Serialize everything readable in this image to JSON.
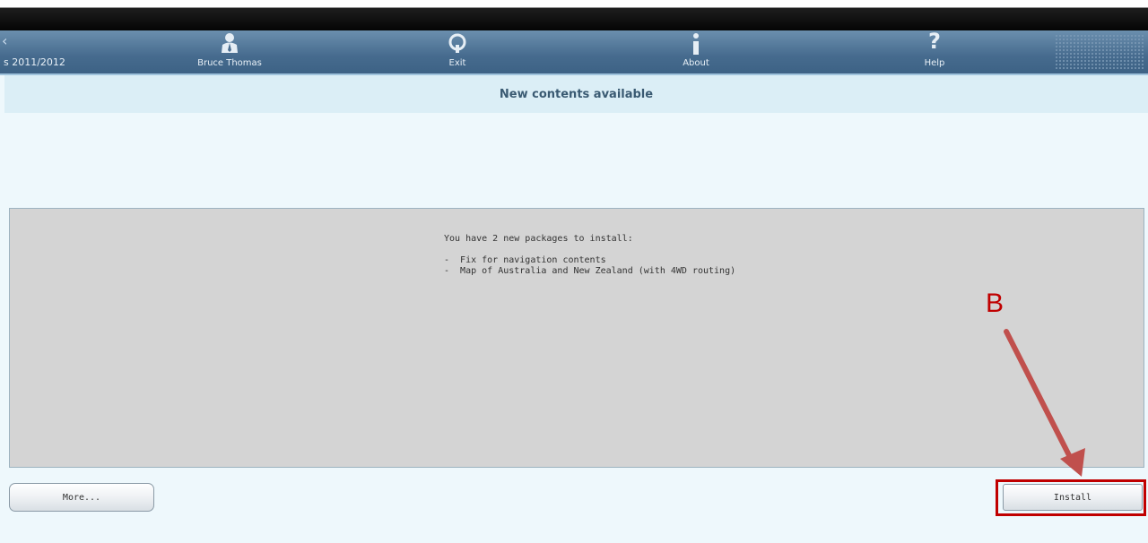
{
  "toolbar": {
    "year_label": "s 2011/2012",
    "items": [
      {
        "label": "Bruce Thomas",
        "icon": "user-icon"
      },
      {
        "label": "Exit",
        "icon": "power-icon"
      },
      {
        "label": "About",
        "icon": "info-icon"
      },
      {
        "label": "Help",
        "icon": "help-icon"
      }
    ]
  },
  "page": {
    "title": "New contents available"
  },
  "message": {
    "intro": "You have 2 new packages to install:",
    "packages": [
      "-  Fix for navigation contents",
      "-  Map of Australia and New Zealand (with 4WD routing)"
    ]
  },
  "buttons": {
    "more": "More...",
    "install": "Install"
  },
  "annotation": {
    "letter": "B",
    "color": "#c00000"
  }
}
